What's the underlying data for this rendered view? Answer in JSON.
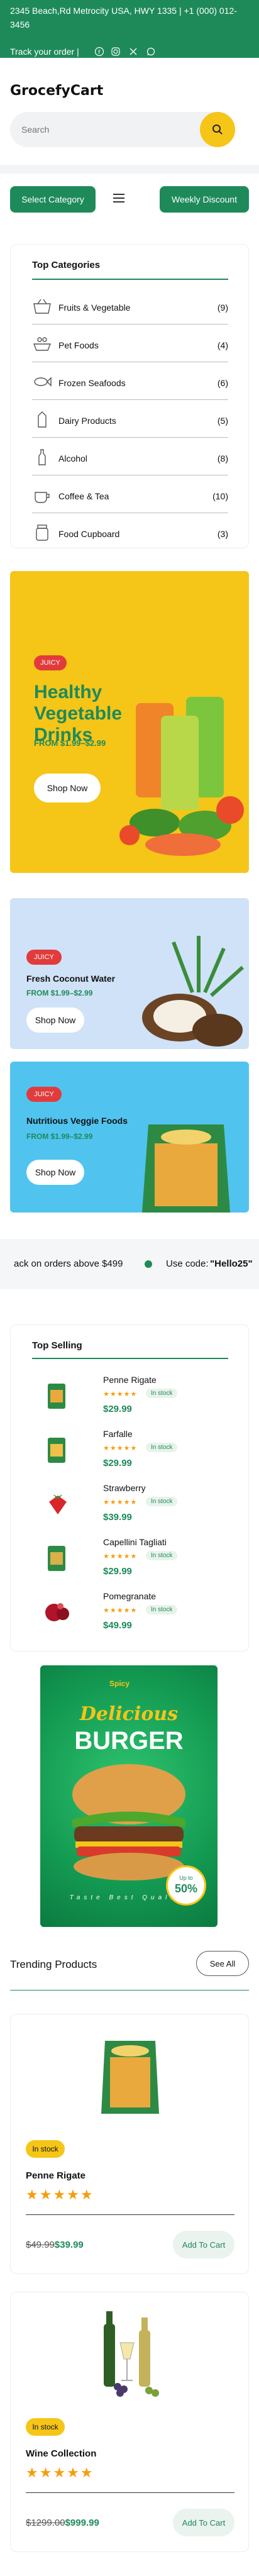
{
  "topbar": {
    "address": "2345 Beach,Rd Metrocity USA, HWY 1335 | +1 (000) 012-3456",
    "track_order": "Track your order |",
    "social_icons": [
      "facebook-icon",
      "instagram-icon",
      "x-icon",
      "whatsapp-icon"
    ]
  },
  "brand": {
    "logo": "GrocefyCart"
  },
  "search": {
    "placeholder": "Search"
  },
  "nav": {
    "select_category": "Select Category",
    "weekly_discount": "Weekly Discount"
  },
  "categories": {
    "title": "Top Categories",
    "items": [
      {
        "label": "Fruits & Vegetable",
        "count": "(9)"
      },
      {
        "label": "Pet Foods",
        "count": "(4)"
      },
      {
        "label": "Frozen Seafoods",
        "count": "(6)"
      },
      {
        "label": "Dairy Products",
        "count": "(5)"
      },
      {
        "label": "Alcohol",
        "count": "(8)"
      },
      {
        "label": "Coffee & Tea",
        "count": "(10)"
      },
      {
        "label": "Food Cupboard",
        "count": "(3)"
      }
    ]
  },
  "promos": [
    {
      "badge": "JUICY",
      "title": "Healthy Vegetable Drinks",
      "price": "FROM $1.99–$2.99",
      "cta": "Shop Now"
    },
    {
      "badge": "JUICY",
      "title": "Fresh Coconut Water",
      "price": "FROM $1.99–$2.99",
      "cta": "Shop Now"
    },
    {
      "badge": "JUICY",
      "title": "Nutritious Veggie Foods",
      "price": "FROM $1.99–$2.99",
      "cta": "Shop Now"
    }
  ],
  "marquee": {
    "left_text": "ack on orders above $499",
    "right_prefix": "Use code:",
    "right_code": "\"Hello25\""
  },
  "top_selling": {
    "title": "Top Selling",
    "items": [
      {
        "name": "Penne Rigate",
        "stock": "In stock",
        "price": "$29.99"
      },
      {
        "name": "Farfalle",
        "stock": "In stock",
        "price": "$29.99"
      },
      {
        "name": "Strawberry",
        "stock": "In stock",
        "price": "$39.99"
      },
      {
        "name": "Capellini Tagliati",
        "stock": "In stock",
        "price": "$29.99"
      },
      {
        "name": "Pomegranate",
        "stock": "In stock",
        "price": "$49.99"
      }
    ]
  },
  "burger_ad": {
    "brand": "Spicy",
    "line1": "Delicious",
    "line2": "BURGER",
    "tagline": "Taste Best Quality",
    "discount_top": "Up to",
    "discount": "50%"
  },
  "trending": {
    "title": "Trending Products",
    "see_all": "See All",
    "products": [
      {
        "stock": "In stock",
        "name": "Penne Rigate",
        "old_price": "$49.99",
        "new_price": "$39.99",
        "cta": "Add To Cart"
      },
      {
        "stock": "In stock",
        "name": "Wine Collection",
        "old_price": "$1299.00",
        "new_price": "$999.99",
        "cta": "Add To Cart"
      }
    ]
  },
  "colors": {
    "primary_green": "#1e8a5a",
    "accent_yellow": "#f5c518",
    "badge_red": "#e23b3b",
    "star": "#f59e0b"
  }
}
